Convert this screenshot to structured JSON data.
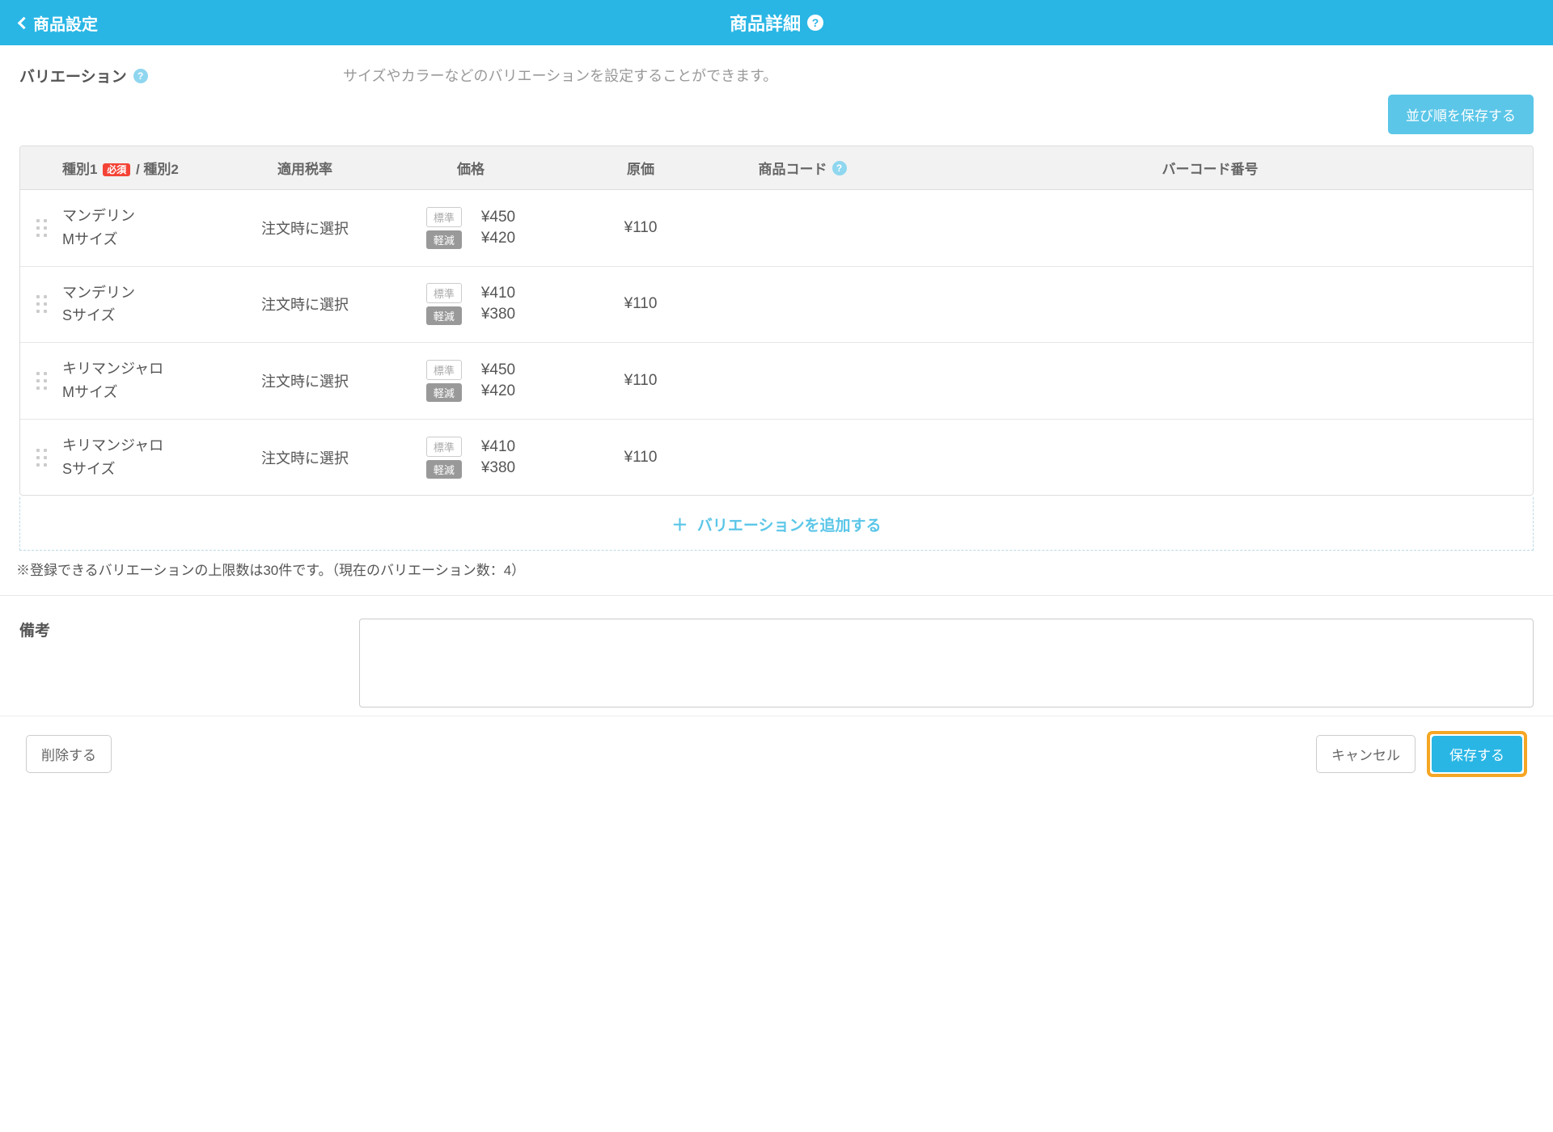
{
  "header": {
    "back_label": "商品設定",
    "title": "商品詳細"
  },
  "section": {
    "label": "バリエーション",
    "description": "サイズやカラーなどのバリエーションを設定することができます。"
  },
  "buttons": {
    "save_order": "並び順を保存する",
    "add_variation": "バリエーションを追加する",
    "delete": "削除する",
    "cancel": "キャンセル",
    "save": "保存する"
  },
  "table": {
    "headers": {
      "type1": "種別1",
      "required": "必須",
      "type2": "/ 種別2",
      "tax": "適用税率",
      "price": "価格",
      "cost": "原価",
      "code": "商品コード",
      "barcode": "バーコード番号"
    },
    "badge_std": "標準",
    "badge_reduced": "軽減",
    "rows": [
      {
        "type1": "マンデリン",
        "type2": "Mサイズ",
        "tax": "注文時に選択",
        "price_std": "¥450",
        "price_red": "¥420",
        "cost": "¥110"
      },
      {
        "type1": "マンデリン",
        "type2": "Sサイズ",
        "tax": "注文時に選択",
        "price_std": "¥410",
        "price_red": "¥380",
        "cost": "¥110"
      },
      {
        "type1": "キリマンジャロ",
        "type2": "Mサイズ",
        "tax": "注文時に選択",
        "price_std": "¥450",
        "price_red": "¥420",
        "cost": "¥110"
      },
      {
        "type1": "キリマンジャロ",
        "type2": "Sサイズ",
        "tax": "注文時に選択",
        "price_std": "¥410",
        "price_red": "¥380",
        "cost": "¥110"
      }
    ]
  },
  "limit_note": "※登録できるバリエーションの上限数は30件です。（現在のバリエーション数：4）",
  "memo": {
    "label": "備考"
  }
}
